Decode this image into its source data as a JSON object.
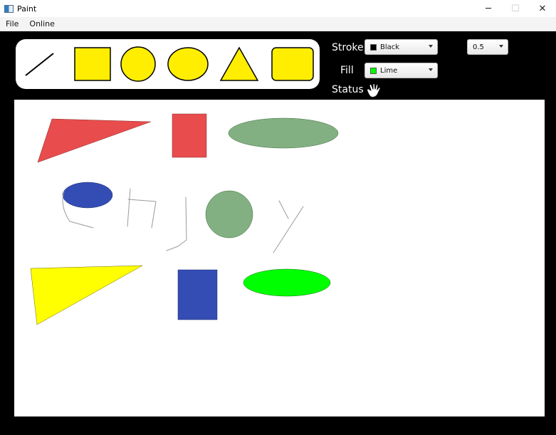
{
  "window": {
    "title": "Paint",
    "minimize_glyph": "─",
    "maximize_glyph": "☐",
    "close_glyph": "✕"
  },
  "menu": {
    "items": [
      "File",
      "Online"
    ]
  },
  "tools": [
    {
      "name": "line-tool",
      "icon": "line-icon"
    },
    {
      "name": "rectangle-tool",
      "icon": "square-icon"
    },
    {
      "name": "circle-tool",
      "icon": "circle-icon"
    },
    {
      "name": "ellipse-tool",
      "icon": "ellipse-icon"
    },
    {
      "name": "triangle-tool",
      "icon": "triangle-icon"
    },
    {
      "name": "rounded-rectangle-tool",
      "icon": "rounded-square-icon"
    }
  ],
  "controls": {
    "stroke_label": "Stroke",
    "stroke_value": "Black",
    "stroke_color": "#000000",
    "width_value": "0.5",
    "fill_label": "Fill",
    "fill_value": "Lime",
    "fill_color": "#00ff00",
    "status_label": "Status",
    "status_icon": "hand-icon"
  },
  "colors": {
    "tool_fill": "#ffee00",
    "red_shape": "#e84c4c",
    "green_shape": "#82b082",
    "blue_shape": "#344db5",
    "yellow_shape": "#ffff00",
    "lime_shape": "#00ff00"
  }
}
